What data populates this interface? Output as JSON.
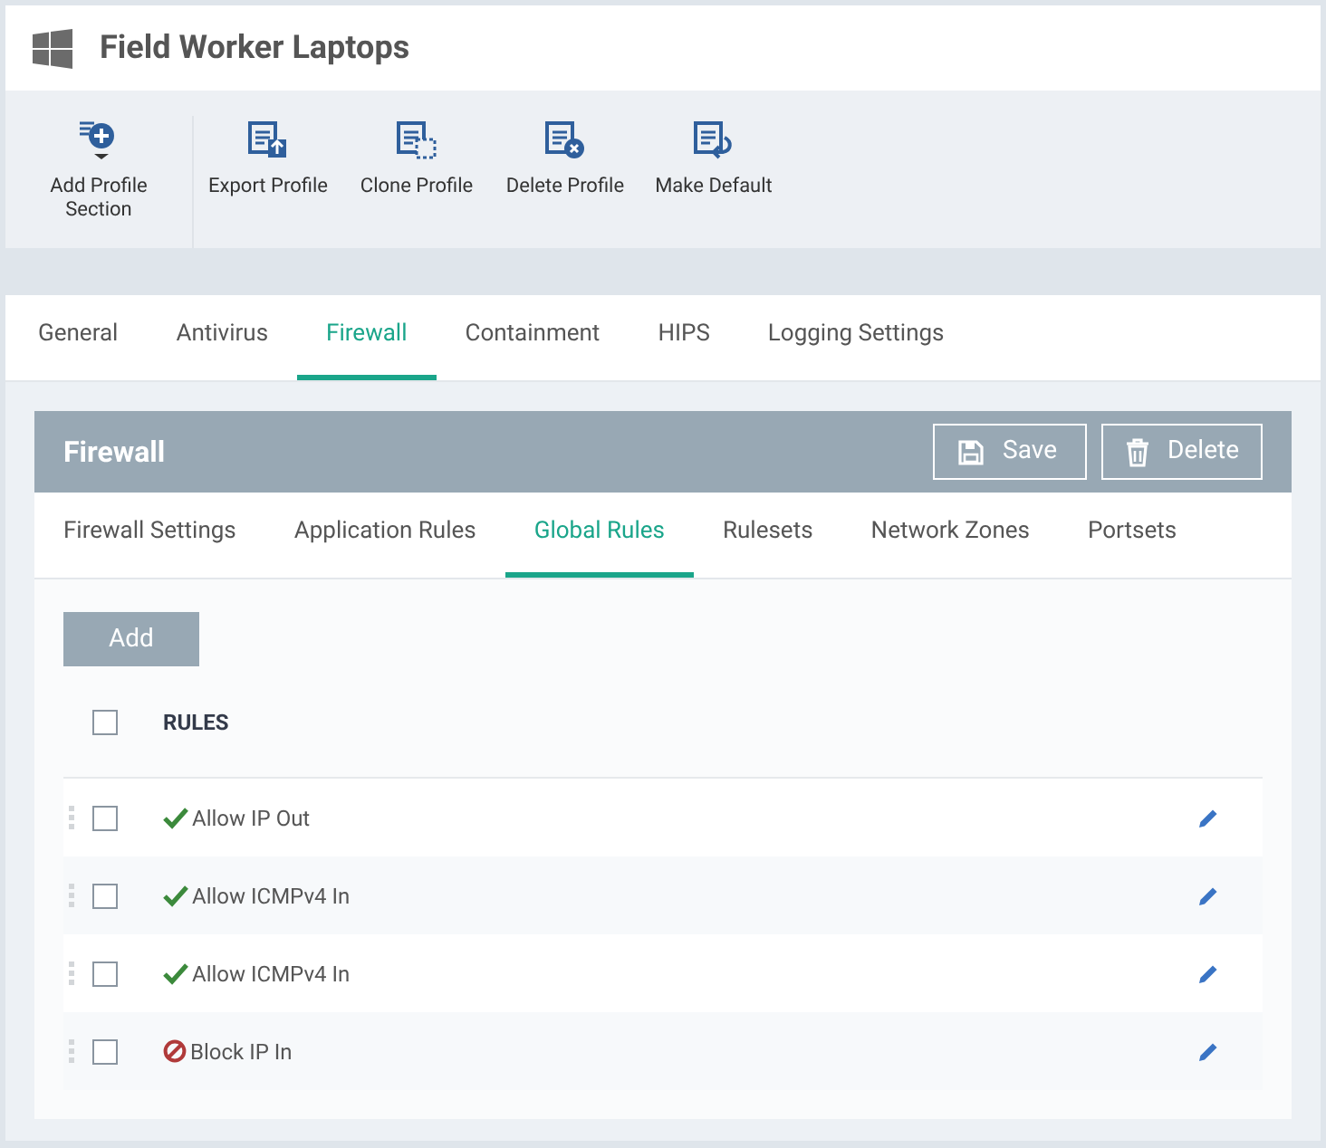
{
  "title": "Field Worker Laptops",
  "toolbar": [
    {
      "label": "Add Profile Section",
      "kind": "add"
    },
    {
      "label": "Export Profile",
      "kind": "export"
    },
    {
      "label": "Clone Profile",
      "kind": "clone"
    },
    {
      "label": "Delete Profile",
      "kind": "delete"
    },
    {
      "label": "Make Default",
      "kind": "default"
    }
  ],
  "tabs": [
    {
      "label": "General",
      "selected": false
    },
    {
      "label": "Antivirus",
      "selected": false
    },
    {
      "label": "Firewall",
      "selected": true
    },
    {
      "label": "Containment",
      "selected": false
    },
    {
      "label": "HIPS",
      "selected": false
    },
    {
      "label": "Logging Settings",
      "selected": false
    }
  ],
  "panel": {
    "title": "Firewall",
    "buttons": [
      {
        "label": "Save",
        "kind": "save"
      },
      {
        "label": "Delete",
        "kind": "delete"
      }
    ],
    "subtabs": [
      {
        "label": "Firewall Settings",
        "selected": false
      },
      {
        "label": "Application Rules",
        "selected": false
      },
      {
        "label": "Global Rules",
        "selected": true
      },
      {
        "label": "Rulesets",
        "selected": false
      },
      {
        "label": "Network Zones",
        "selected": false
      },
      {
        "label": "Portsets",
        "selected": false
      }
    ],
    "add_button": "Add",
    "table": {
      "header": "RULES",
      "header_checked": false,
      "rows": [
        {
          "name": "Allow IP Out",
          "kind": "allow",
          "checked": false
        },
        {
          "name": "Allow ICMPv4 In",
          "kind": "allow",
          "checked": false
        },
        {
          "name": "Allow ICMPv4 In",
          "kind": "allow",
          "checked": false
        },
        {
          "name": "Block IP In",
          "kind": "block",
          "checked": false
        }
      ]
    }
  }
}
